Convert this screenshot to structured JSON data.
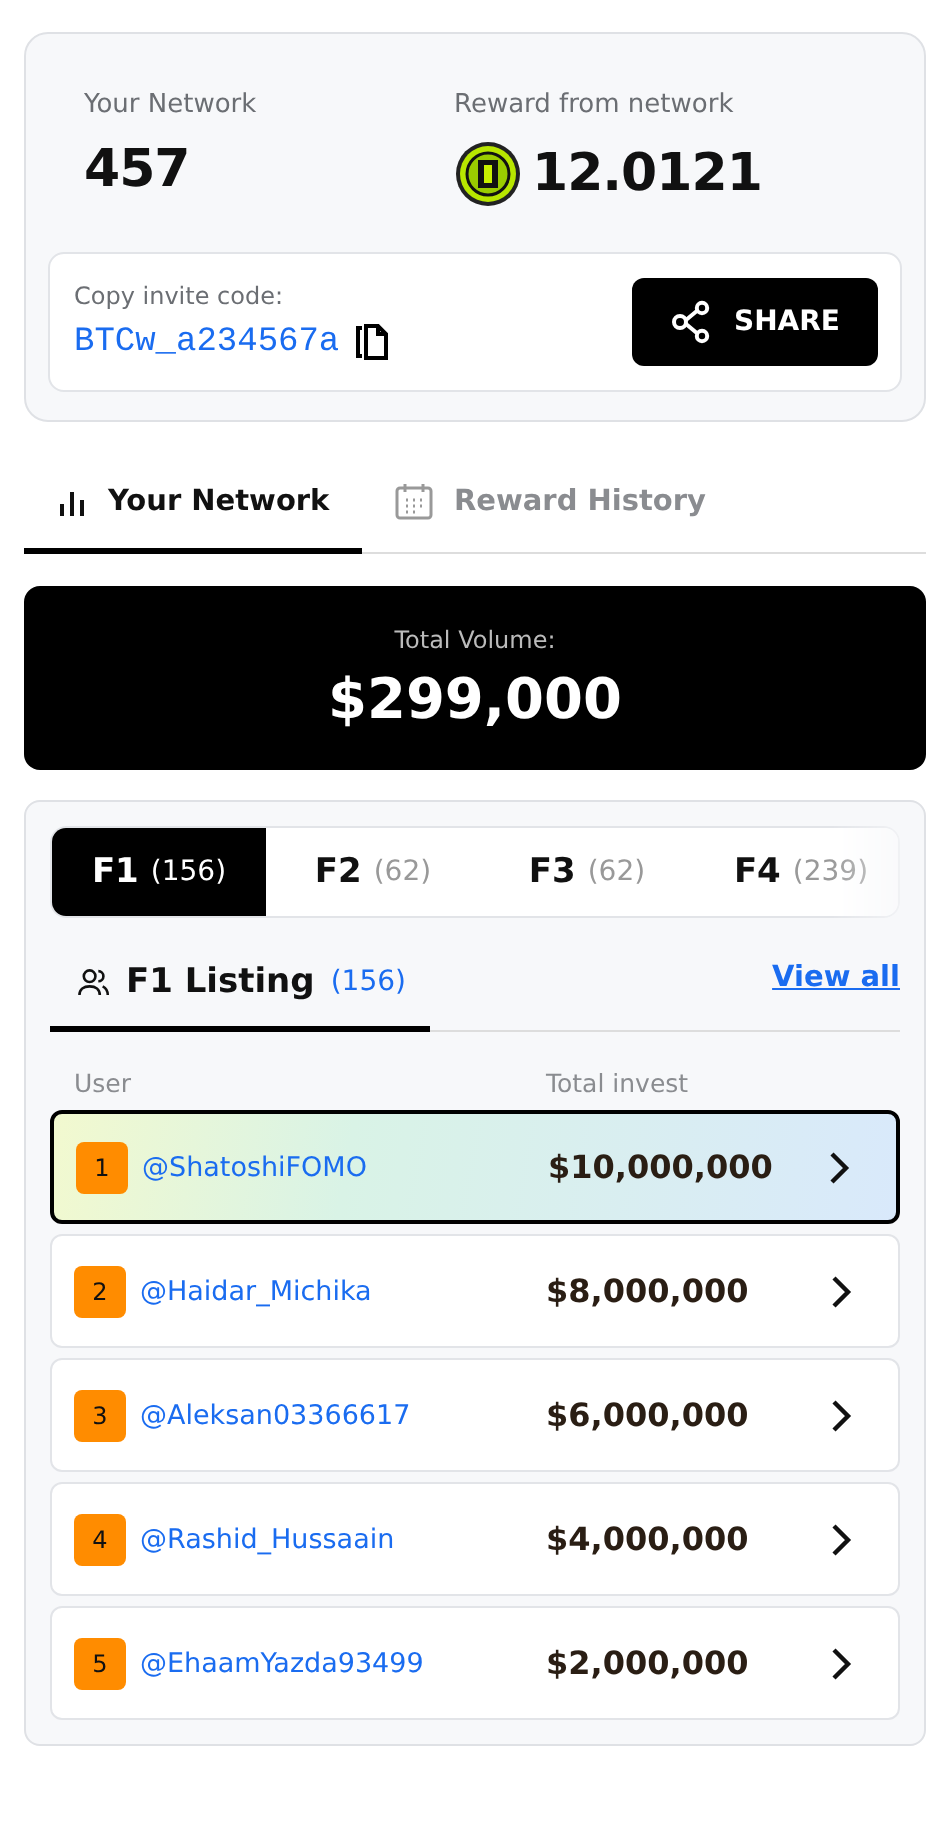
{
  "stats": [
    {
      "label": "Your Network",
      "value": "457",
      "kind": "plain"
    },
    {
      "label": "Reward from network",
      "value": "12.0121",
      "kind": "coin"
    }
  ],
  "invite": {
    "label": "Copy invite code:",
    "code": "BTCw_a234567a",
    "button": "SHARE"
  },
  "tabs": [
    {
      "label": "Your Network",
      "kind": "chart",
      "selected": true
    },
    {
      "label": "Reward History",
      "kind": "calendar",
      "selected": false
    }
  ],
  "total": {
    "label": "Total Volume:",
    "value": "$299,000"
  },
  "levels": [
    {
      "label": "F1",
      "count": "(156)",
      "selected": true
    },
    {
      "label": "F2",
      "count": "(62)",
      "selected": false
    },
    {
      "label": "F3",
      "count": "(62)",
      "selected": false
    },
    {
      "label": "F4",
      "count": "(239)",
      "selected": false
    }
  ],
  "listing": {
    "title": "F1 Listing",
    "count": "(156)",
    "link": "View all"
  },
  "columns": [
    "User",
    "Total invest"
  ],
  "rows": [
    {
      "rank": "1",
      "user": "@ShatoshiFOMO",
      "amount": "$10,000,000",
      "selected": true
    },
    {
      "rank": "2",
      "user": "@Haidar_Michika",
      "amount": "$8,000,000",
      "selected": false
    },
    {
      "rank": "3",
      "user": "@Aleksan03366617",
      "amount": "$6,000,000",
      "selected": false
    },
    {
      "rank": "4",
      "user": "@Rashid_Hussaain",
      "amount": "$4,000,000",
      "selected": false
    },
    {
      "rank": "5",
      "user": "@EhaamYazda93499",
      "amount": "$2,000,000",
      "selected": false
    }
  ]
}
